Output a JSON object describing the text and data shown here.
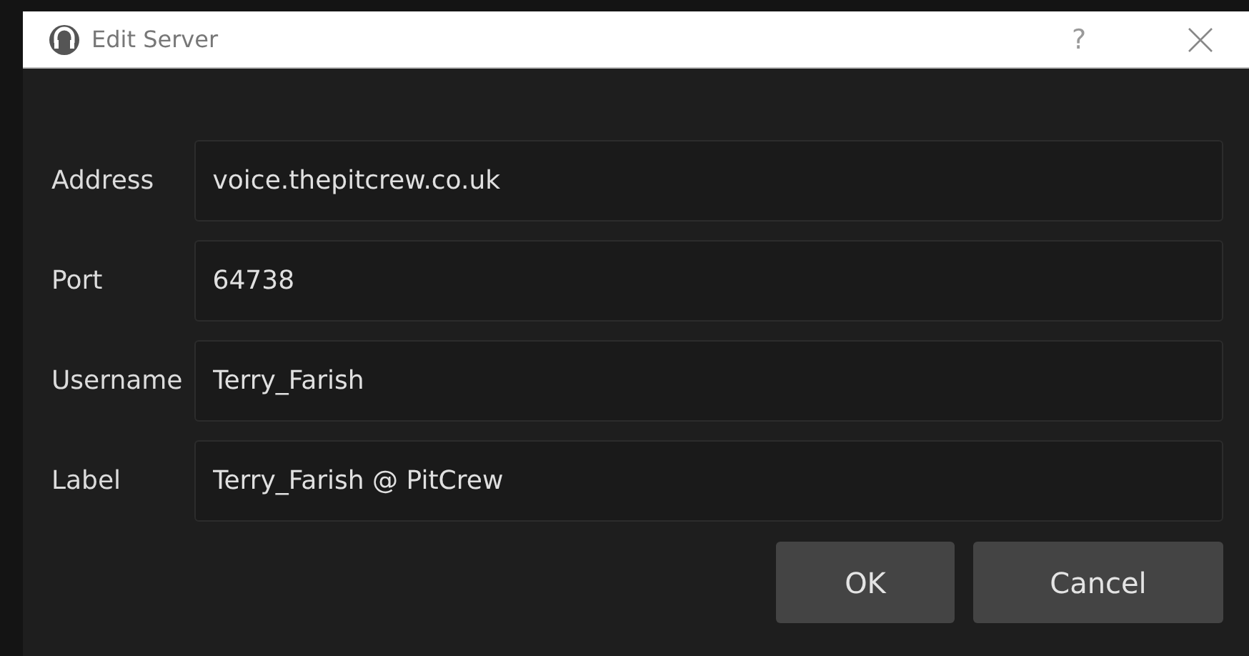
{
  "window": {
    "title": "Edit Server",
    "help": "?"
  },
  "fields": [
    {
      "label": "Address",
      "value": "voice.thepitcrew.co.uk"
    },
    {
      "label": "Port",
      "value": "64738"
    },
    {
      "label": "Username",
      "value": "Terry_Farish"
    },
    {
      "label": "Label",
      "value": "Terry_Farish @ PitCrew"
    }
  ],
  "buttons": [
    "OK",
    "Cancel"
  ]
}
